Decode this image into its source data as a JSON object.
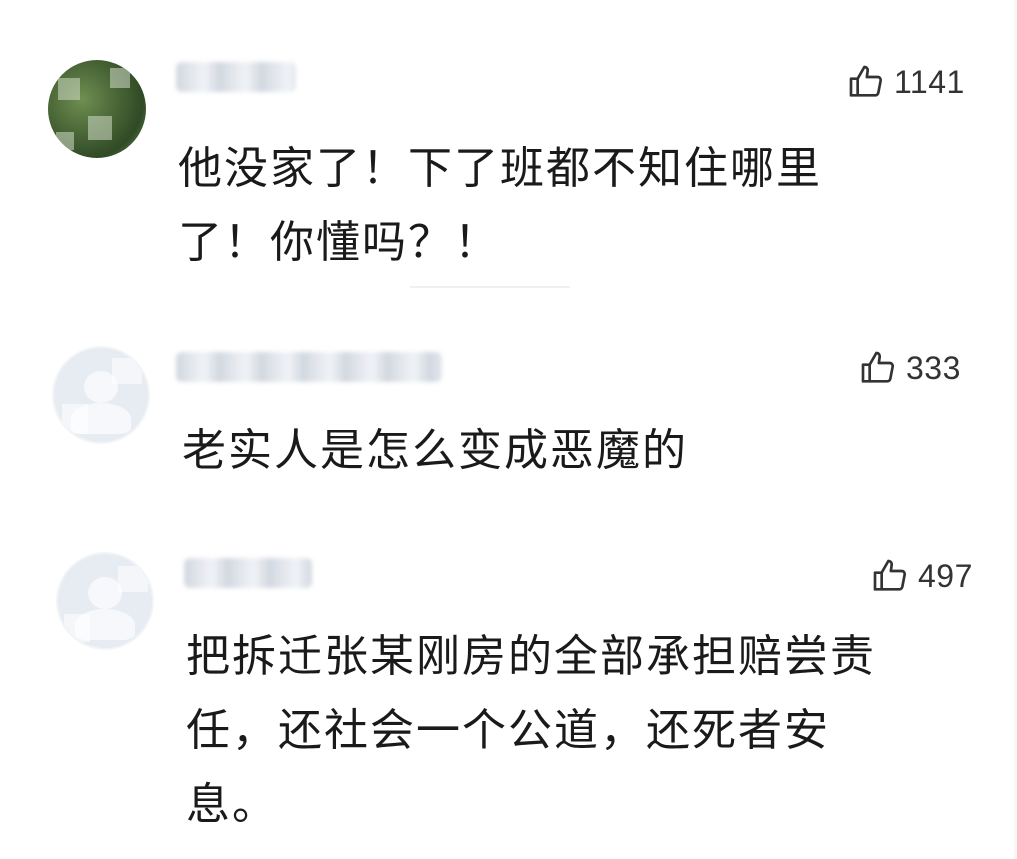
{
  "comments": [
    {
      "likes": "1141",
      "text_line1": "他没家了！下了班都不知住哪里",
      "text_line2": "了！你懂吗？！"
    },
    {
      "likes": "333",
      "text_line1": "老实人是怎么变成恶魔的"
    },
    {
      "likes": "497",
      "text_line1": "把拆迁张某刚房的全部承担赔尝责",
      "text_line2": "任，还社会一个公道，还死者安",
      "text_line3": "息。"
    }
  ],
  "icons": {
    "like": "thumbs-up-icon",
    "avatar": "user-avatar"
  },
  "colors": {
    "text": "#1a1a1a",
    "like_count": "#333333",
    "background": "#ffffff",
    "default_avatar": "#e7ecf2"
  }
}
